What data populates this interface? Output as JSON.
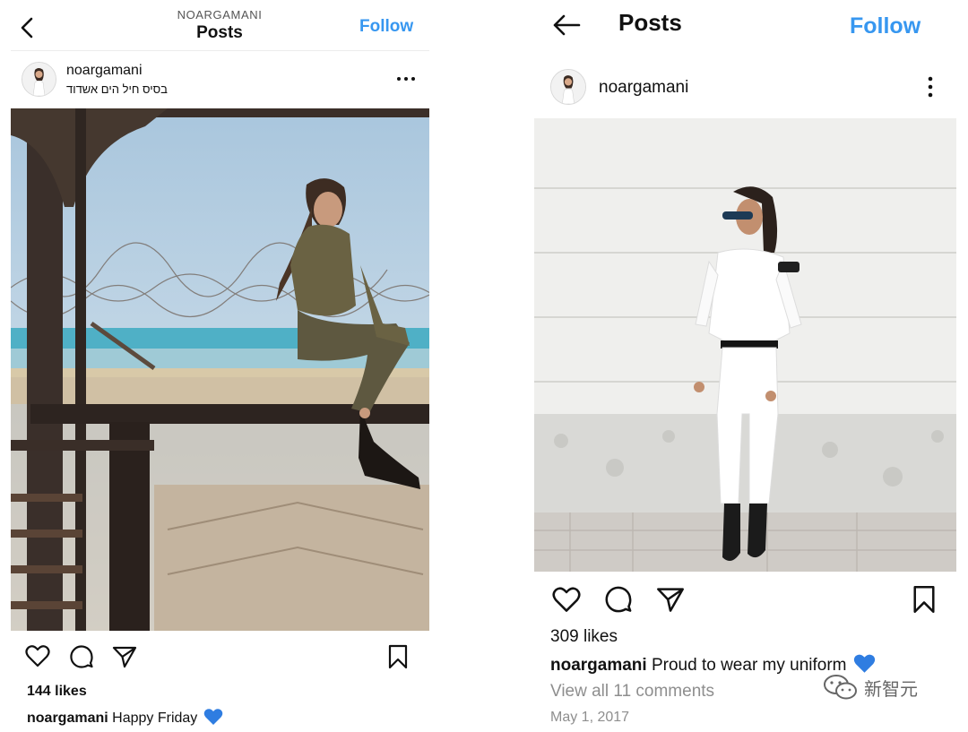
{
  "left_post": {
    "header": {
      "account_title": "NOARGAMANI",
      "screen_title": "Posts",
      "follow_label": "Follow"
    },
    "username": "noargamani",
    "location": "בסיס חיל הים אשדוד",
    "likes": "144 likes",
    "caption": {
      "user": "noargamani",
      "text": "Happy Friday"
    },
    "photo_icon": "photo-soldier-on-bench"
  },
  "right_post": {
    "header": {
      "screen_title": "Posts",
      "follow_label": "Follow"
    },
    "username": "noargamani",
    "likes": "309 likes",
    "caption": {
      "user": "noargamani",
      "text": "Proud to wear my uniform"
    },
    "comments_link": "View all 11 comments",
    "date": "May 1, 2017",
    "photo_icon": "photo-navy-uniform-wall"
  },
  "watermark": {
    "text": "新智元",
    "icon": "wechat-icon"
  },
  "icons": {
    "back": "chevron-left-icon",
    "back_arrow": "arrow-left-icon",
    "more": "more-horizontal-icon",
    "more_vertical": "more-vertical-icon",
    "like": "heart-icon",
    "comment": "comment-icon",
    "share": "send-icon",
    "save": "bookmark-icon",
    "emoji": "blue-heart-icon"
  },
  "colors": {
    "follow": "#3797f0",
    "blue_heart": "#2f7de1",
    "muted": "#8e8e8e"
  }
}
